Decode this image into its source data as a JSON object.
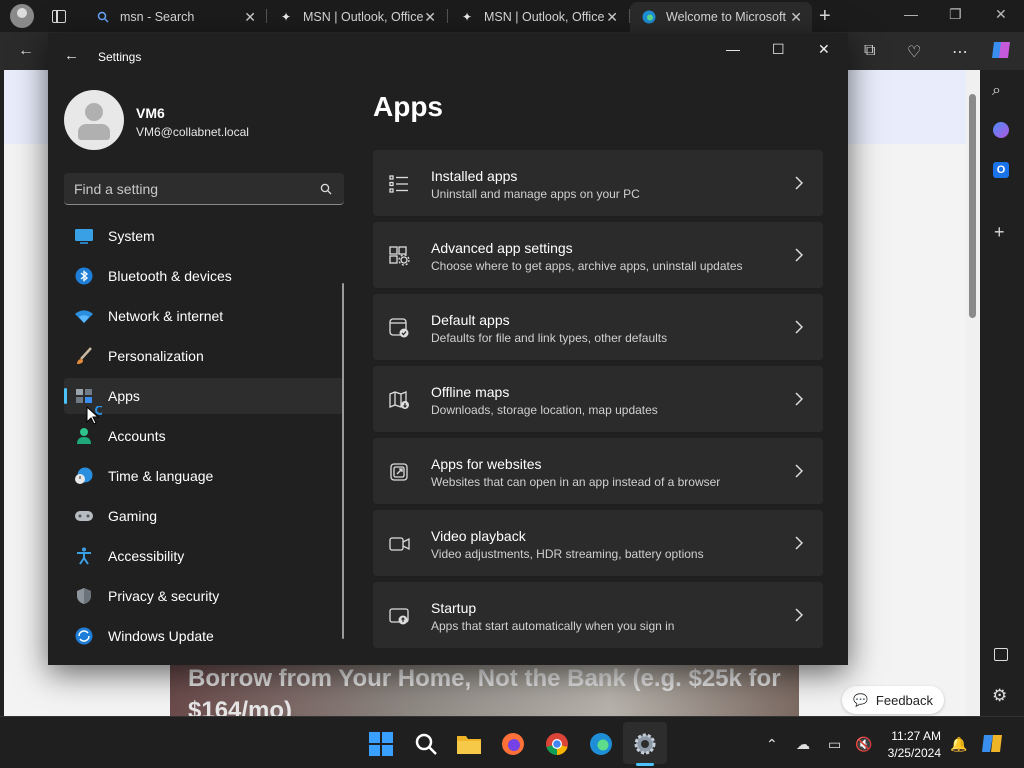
{
  "browser": {
    "tabs": [
      {
        "label": "msn - Search",
        "icon": "search-icon"
      },
      {
        "label": "MSN | Outlook, Office",
        "icon": "msn-butterfly-icon"
      },
      {
        "label": "MSN | Outlook, Office",
        "icon": "msn-butterfly-icon"
      },
      {
        "label": "Welcome to Microsoft",
        "icon": "edge-icon"
      }
    ],
    "page": {
      "ad_text": "Borrow from Your Home, Not the Bank (e.g. $25k for $164/mo)",
      "feedback_label": "Feedback"
    }
  },
  "settings": {
    "title": "Settings",
    "user": {
      "name": "VM6",
      "email": "VM6@collabnet.local"
    },
    "search_placeholder": "Find a setting",
    "nav": [
      {
        "label": "System",
        "icon": "system-icon"
      },
      {
        "label": "Bluetooth & devices",
        "icon": "bluetooth-icon"
      },
      {
        "label": "Network & internet",
        "icon": "wifi-icon"
      },
      {
        "label": "Personalization",
        "icon": "brush-icon"
      },
      {
        "label": "Apps",
        "icon": "apps-icon",
        "selected": true
      },
      {
        "label": "Accounts",
        "icon": "accounts-icon"
      },
      {
        "label": "Time & language",
        "icon": "globe-clock-icon"
      },
      {
        "label": "Gaming",
        "icon": "gamepad-icon"
      },
      {
        "label": "Accessibility",
        "icon": "accessibility-icon"
      },
      {
        "label": "Privacy & security",
        "icon": "shield-icon"
      },
      {
        "label": "Windows Update",
        "icon": "update-icon"
      }
    ],
    "page_title": "Apps",
    "cards": [
      {
        "title": "Installed apps",
        "desc": "Uninstall and manage apps on your PC",
        "icon": "list-icon"
      },
      {
        "title": "Advanced app settings",
        "desc": "Choose where to get apps, archive apps, uninstall updates",
        "icon": "app-gear-icon"
      },
      {
        "title": "Default apps",
        "desc": "Defaults for file and link types, other defaults",
        "icon": "default-app-icon"
      },
      {
        "title": "Offline maps",
        "desc": "Downloads, storage location, map updates",
        "icon": "map-icon"
      },
      {
        "title": "Apps for websites",
        "desc": "Websites that can open in an app instead of a browser",
        "icon": "open-external-icon"
      },
      {
        "title": "Video playback",
        "desc": "Video adjustments, HDR streaming, battery options",
        "icon": "video-icon"
      },
      {
        "title": "Startup",
        "desc": "Apps that start automatically when you sign in",
        "icon": "startup-icon"
      }
    ]
  },
  "taskbar": {
    "time": "11:27 AM",
    "date": "3/25/2024"
  },
  "colors": {
    "accent": "#4cc2ff",
    "window_bg": "#202020",
    "card_bg": "#2b2b2b"
  }
}
